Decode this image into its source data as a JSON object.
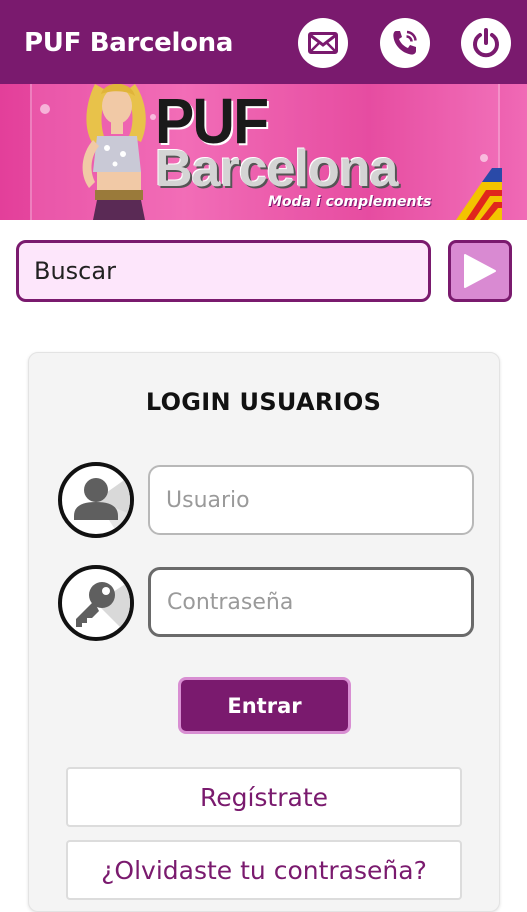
{
  "appbar": {
    "title": "PUF Barcelona",
    "icons": [
      "mail-icon",
      "phone-icon",
      "power-icon"
    ]
  },
  "banner": {
    "line1": "PUF",
    "line2": "Barcelona",
    "tagline": "Moda i complements"
  },
  "search": {
    "placeholder": "Buscar",
    "value": "Buscar",
    "go_icon": "play-icon"
  },
  "login": {
    "title": "LOGIN USUARIOS",
    "user_placeholder": "Usuario",
    "password_placeholder": "Contraseña",
    "submit_label": "Entrar",
    "register_label": "Regístrate",
    "forgot_label": "¿Olvidaste tu contraseña?"
  },
  "colors": {
    "brand": "#7a1a6e",
    "banner_pink": "#e33f9a",
    "search_bg": "#fde6fb",
    "accent_light": "#d98ad2"
  }
}
